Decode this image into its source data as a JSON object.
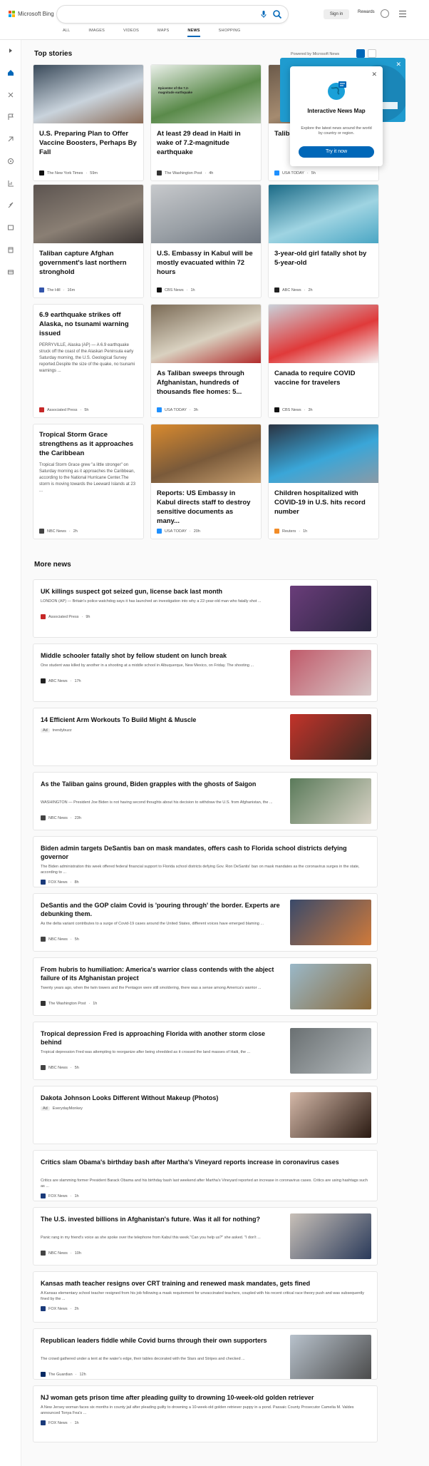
{
  "header": {
    "logo_text": "Microsoft Bing",
    "search_placeholder": "",
    "signin": "Sign in",
    "rewards": "Rewards",
    "scopes": [
      "ALL",
      "IMAGES",
      "VIDEOS",
      "MAPS",
      "NEWS",
      "SHOPPING"
    ],
    "active_scope": "NEWS"
  },
  "top": {
    "title": "Top stories",
    "powered": "Powered by Microsoft News"
  },
  "popup": {
    "title": "Interactive News Map",
    "desc": "Explore the latest news around the world by country or region.",
    "button": "Try it now"
  },
  "cards": [
    {
      "title": "U.S. Preparing Plan to Offer Vaccine Boosters, Perhaps By Fall",
      "snippet": "",
      "source": "The New York Times",
      "time": "59m",
      "src_color": "#111"
    },
    {
      "title": "At least 29 dead in Haiti in wake of 7.2-magnitude earthquake",
      "snippet": "",
      "source": "The Washington Post",
      "time": "4h",
      "src_color": "#333",
      "map_label": "Epicenter of the 7.2-magnitude earthquake"
    },
    {
      "title": "Taliban ... tests ... foreign ...",
      "snippet": "",
      "source": "USA TODAY",
      "time": "5h",
      "src_color": "#1e90ff"
    },
    {
      "title": "Taliban capture Afghan government's last northern stronghold",
      "snippet": "",
      "source": "The Hill",
      "time": "16m",
      "src_color": "#3355aa"
    },
    {
      "title": "U.S. Embassy in Kabul will be mostly evacuated within 72 hours",
      "snippet": "",
      "source": "CBS News",
      "time": "1h",
      "src_color": "#111"
    },
    {
      "title": "3-year-old girl fatally shot by 5-year-old",
      "snippet": "",
      "source": "ABC News",
      "time": "2h",
      "src_color": "#222"
    },
    {
      "title": "6.9 earthquake strikes off Alaska, no tsunami warning issued",
      "snippet": "PERRYVILLE, Alaska (AP) — A 6.9 earthquake struck off the coast of the Alaskan Peninsula early Saturday morning, the U.S. Geological Survey reported.Despite the size of the quake, no tsunami warnings ...",
      "source": "Associated Press",
      "time": "5h",
      "src_color": "#c62828"
    },
    {
      "title": "As Taliban sweeps through Afghanistan, hundreds of thousands flee homes: 5...",
      "snippet": "",
      "source": "USA TODAY",
      "time": "3h",
      "src_color": "#1e90ff"
    },
    {
      "title": "Canada to require COVID vaccine for travelers",
      "snippet": "",
      "source": "CBS News",
      "time": "3h",
      "src_color": "#111"
    },
    {
      "title": "Tropical Storm Grace strengthens as it approaches the Caribbean",
      "snippet": "Tropical Storm Grace grew \"a little stronger\" on Saturday morning as it approaches the Caribbean, according to the National Hurricane Center.The storm is moving towards the Leeward Islands at 23 ...",
      "source": "NBC News",
      "time": "2h",
      "src_color": "#444"
    },
    {
      "title": "Reports: US Embassy in Kabul directs staff to destroy sensitive documents as many...",
      "snippet": "",
      "source": "USA TODAY",
      "time": "20h",
      "src_color": "#1e90ff"
    },
    {
      "title": "Children hospitalized with COVID-19 in U.S. hits record number",
      "snippet": "",
      "source": "Reuters",
      "time": "1h",
      "src_color": "#f28c28"
    }
  ],
  "more": {
    "title": "More news",
    "rows": [
      {
        "title": "UK killings suspect got seized gun, license back last month",
        "snippet": "LONDON (AP) — Britain's police watchdog says it has launched an investigation into why a 22-year-old man who fatally shot ...",
        "source": "Associated Press",
        "time": "9h",
        "ad": false,
        "src_color": "#c62828"
      },
      {
        "title": "Middle schooler fatally shot by fellow student on lunch break",
        "snippet": "One student was killed by another in a shooting at a middle school in Albuquerque, New Mexico, on Friday. The shooting ...",
        "source": "ABC News",
        "time": "17h",
        "ad": false,
        "src_color": "#222"
      },
      {
        "title": "14 Efficient Arm Workouts To Build Might & Muscle",
        "snippet": "",
        "source": "trendybuzz",
        "time": "",
        "ad": true,
        "ad_label": "Ad",
        "src_color": ""
      },
      {
        "title": "As the Taliban gains ground, Biden grapples with the ghosts of Saigon",
        "snippet": "WASHINGTON — President Joe Biden is not having second thoughts about his decision to withdraw the U.S. from Afghanistan, the ...",
        "source": "NBC News",
        "time": "23h",
        "ad": false,
        "src_color": "#444"
      },
      {
        "title": "Biden admin targets DeSantis ban on mask mandates, offers cash to Florida school districts defying governor",
        "snippet": "The Biden administration this week offered federal financial support to Florida school districts defying Gov. Ron DeSantis' ban on mask mandates as the coronavirus surges in the state, according to ...",
        "source": "FOX News",
        "time": "8h",
        "ad": false,
        "src_color": "#1a3a7a"
      },
      {
        "title": "DeSantis and the GOP claim Covid is 'pouring through' the border. Experts are debunking them.",
        "snippet": "As the delta variant contributes to a surge of Covid-19 cases around the United States, different voices have emerged blaming ...",
        "source": "NBC News",
        "time": "5h",
        "ad": false,
        "src_color": "#444"
      },
      {
        "title": "From hubris to humiliation: America's warrior class contends with the abject failure of its Afghanistan project",
        "snippet": "Twenty years ago, when the twin towers and the Pentagon were still smoldering, there was a sense among America's warrior ...",
        "source": "The Washington Post",
        "time": "1h",
        "ad": false,
        "src_color": "#333"
      },
      {
        "title": "Tropical depression Fred is approaching Florida with another storm close behind",
        "snippet": "Tropical depression Fred was attempting to reorganize after being shredded as it crossed the land masses of Haiti, the ...",
        "source": "NBC News",
        "time": "5h",
        "ad": false,
        "src_color": "#444"
      },
      {
        "title": "Dakota Johnson Looks Different Without Makeup (Photos)",
        "snippet": "",
        "source": "EverydayMonkey",
        "time": "",
        "ad": true,
        "ad_label": "Ad",
        "src_color": ""
      },
      {
        "title": "Critics slam Obama's birthday bash after Martha's Vineyard reports increase in coronavirus cases",
        "snippet": "Critics are slamming former President Barack Obama and his birthday bash last weekend after Martha's Vineyard reported an increase in coronavirus cases. Critics are using hashtags such as ...",
        "source": "FOX News",
        "time": "1h",
        "ad": false,
        "src_color": "#1a3a7a"
      },
      {
        "title": "The U.S. invested billions in Afghanistan's future. Was it all for nothing?",
        "snippet": "Panic rang in my friend's voice as she spoke over the telephone from Kabul this week.\"Can you help us?\" she asked. \"I don't ...",
        "source": "NBC News",
        "time": "10h",
        "ad": false,
        "src_color": "#444"
      },
      {
        "title": "Kansas math teacher resigns over CRT training and renewed mask mandates, gets fined",
        "snippet": "A Kansas elementary school teacher resigned from his job following a mask requirement for unvaccinated teachers, coupled with his recent critical race theory push and was subsequently fined by the ...",
        "source": "FOX News",
        "time": "2h",
        "ad": false,
        "src_color": "#1a3a7a"
      },
      {
        "title": "Republican leaders fiddle while Covid burns through their own supporters",
        "snippet": "The crowd gathered under a tent at the water's edge, their tables decorated with the Stars and Stripes and checked ...",
        "source": "The Guardian",
        "time": "12h",
        "ad": false,
        "src_color": "#052962"
      },
      {
        "title": "NJ woman gets prison time after pleading guilty to drowning 10-week-old golden retriever",
        "snippet": "A New Jersey woman faces six months in county jail after pleading guilty to drowning a 10-week-old golden retriever puppy in a pond. Passaic County Prosecutor Camelia M. Valdes announced Tonya Fea's ...",
        "source": "FOX News",
        "time": "1h",
        "ad": false,
        "src_color": "#1a3a7a"
      }
    ]
  }
}
